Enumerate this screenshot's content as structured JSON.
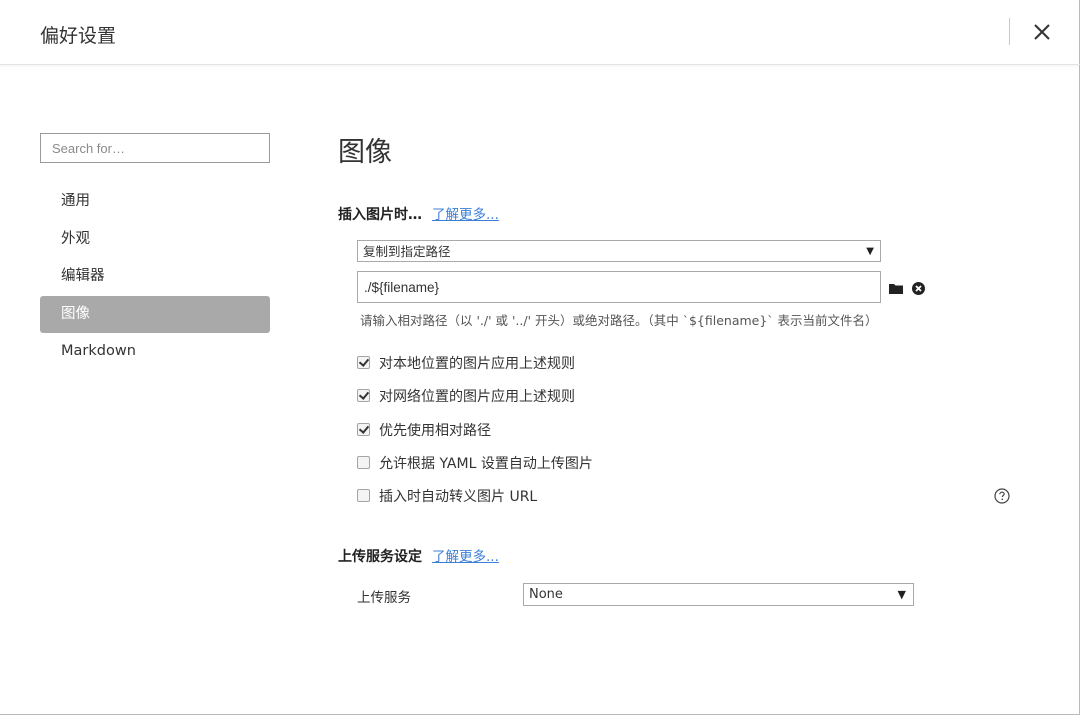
{
  "window": {
    "title": "偏好设置"
  },
  "sidebar": {
    "search_placeholder": "Search for…",
    "items": [
      {
        "label": "通用"
      },
      {
        "label": "外观"
      },
      {
        "label": "编辑器"
      },
      {
        "label": "图像",
        "active": true
      },
      {
        "label": "Markdown"
      }
    ]
  },
  "main": {
    "title": "图像",
    "insert_section": {
      "heading": "插入图片时…",
      "learn_more": "了解更多...",
      "action_select": "复制到指定路径",
      "path_value": "./${filename}",
      "hint": "请输入相对路径（以 './' 或 '../' 开头）或绝对路径。（其中 `${filename}` 表示当前文件名）",
      "options": [
        {
          "label": "对本地位置的图片应用上述规则",
          "checked": true
        },
        {
          "label": "对网络位置的图片应用上述规则",
          "checked": true
        },
        {
          "label": "优先使用相对路径",
          "checked": true
        },
        {
          "label": "允许根据 YAML 设置自动上传图片",
          "checked": false
        },
        {
          "label": "插入时自动转义图片 URL",
          "checked": false
        }
      ]
    },
    "upload_section": {
      "heading": "上传服务设定",
      "learn_more": "了解更多...",
      "service_label": "上传服务",
      "service_value": "None"
    }
  },
  "icons": {
    "close": "close-icon",
    "folder": "folder-icon",
    "clear": "clear-circle-icon",
    "help": "help-circle-icon",
    "caret": "caret-down-icon"
  }
}
